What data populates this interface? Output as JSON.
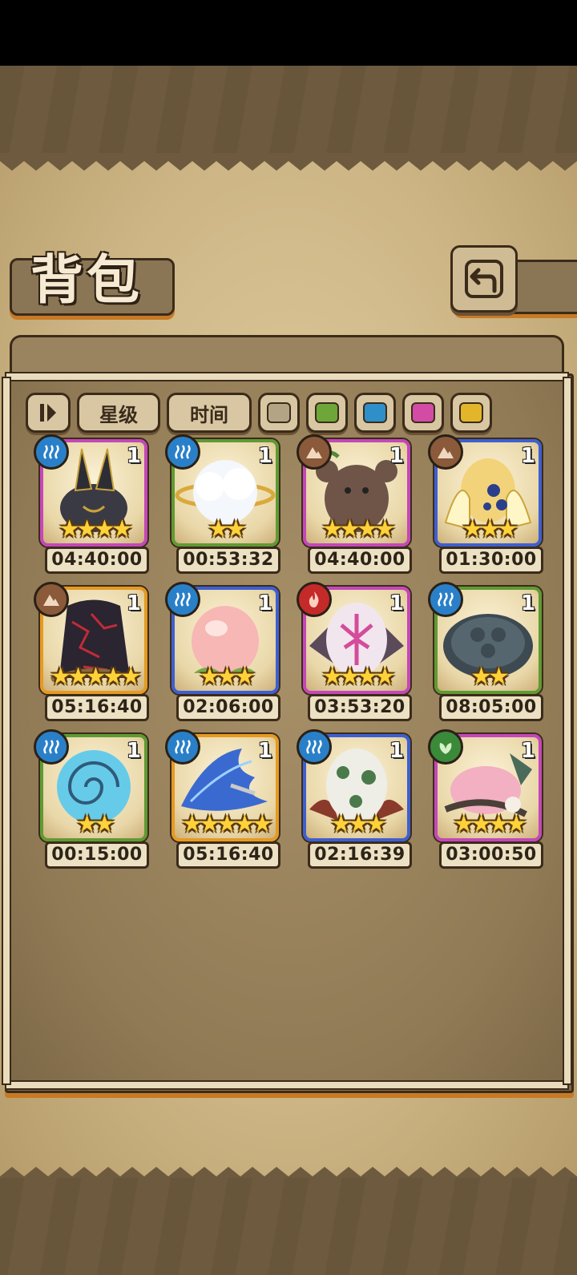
{
  "header": {
    "title": "背包"
  },
  "filters": {
    "sort_icon": "sort-toggle-icon",
    "star_label": "星级",
    "time_label": "时间",
    "colors": [
      "#b3a485",
      "#6fa63a",
      "#2f8fc9",
      "#d24ca6",
      "#e3b52b"
    ]
  },
  "items": [
    {
      "name": "black-rabbit-egg",
      "count": "1",
      "stars": "★★★★",
      "timer": "04:40:00",
      "frame": "#c447b9",
      "element": "water"
    },
    {
      "name": "cloud-egg",
      "count": "1",
      "stars": "★★",
      "timer": "00:53:32",
      "frame": "#5f9a33",
      "element": "water"
    },
    {
      "name": "brown-bear-egg",
      "count": "1",
      "stars": "★★★★",
      "timer": "04:40:00",
      "frame": "#c447b9",
      "element": "earth"
    },
    {
      "name": "jelly-egg",
      "count": "1",
      "stars": "★★★",
      "timer": "01:30:00",
      "frame": "#3d5fd0",
      "element": "earth"
    },
    {
      "name": "dark-crack-egg",
      "count": "1",
      "stars": "★★★★★",
      "timer": "05:16:40",
      "frame": "#e59a22",
      "element": "earth"
    },
    {
      "name": "peach-egg",
      "count": "1",
      "stars": "★★★",
      "timer": "02:06:00",
      "frame": "#3d5fd0",
      "element": "water"
    },
    {
      "name": "winged-pink-egg",
      "count": "1",
      "stars": "★★★★",
      "timer": "03:53:20",
      "frame": "#c447b9",
      "element": "fire"
    },
    {
      "name": "turtle-shell-egg",
      "count": "1",
      "stars": "★★",
      "timer": "08:05:00",
      "frame": "#5f9a33",
      "element": "water"
    },
    {
      "name": "spiral-shell-egg",
      "count": "1",
      "stars": "★★",
      "timer": "00:15:00",
      "frame": "#5f9a33",
      "element": "water"
    },
    {
      "name": "blue-feather-egg",
      "count": "1",
      "stars": "★★★★★",
      "timer": "05:16:40",
      "frame": "#e59a22",
      "element": "water"
    },
    {
      "name": "mossy-egg",
      "count": "1",
      "stars": "★★★",
      "timer": "02:16:39",
      "frame": "#3d5fd0",
      "element": "water"
    },
    {
      "name": "pink-creature-egg",
      "count": "1",
      "stars": "★★★★",
      "timer": "03:00:50",
      "frame": "#c447b9",
      "element": "grass"
    }
  ],
  "element_colors": {
    "water": "#2a80c8",
    "earth": "#8a5a3a",
    "fire": "#c42a2a",
    "grass": "#3a8a3a"
  },
  "icons": {
    "back": "return-icon",
    "water": "water-wave-icon",
    "earth": "mountain-icon",
    "fire": "flame-icon",
    "grass": "leaf-icon"
  }
}
